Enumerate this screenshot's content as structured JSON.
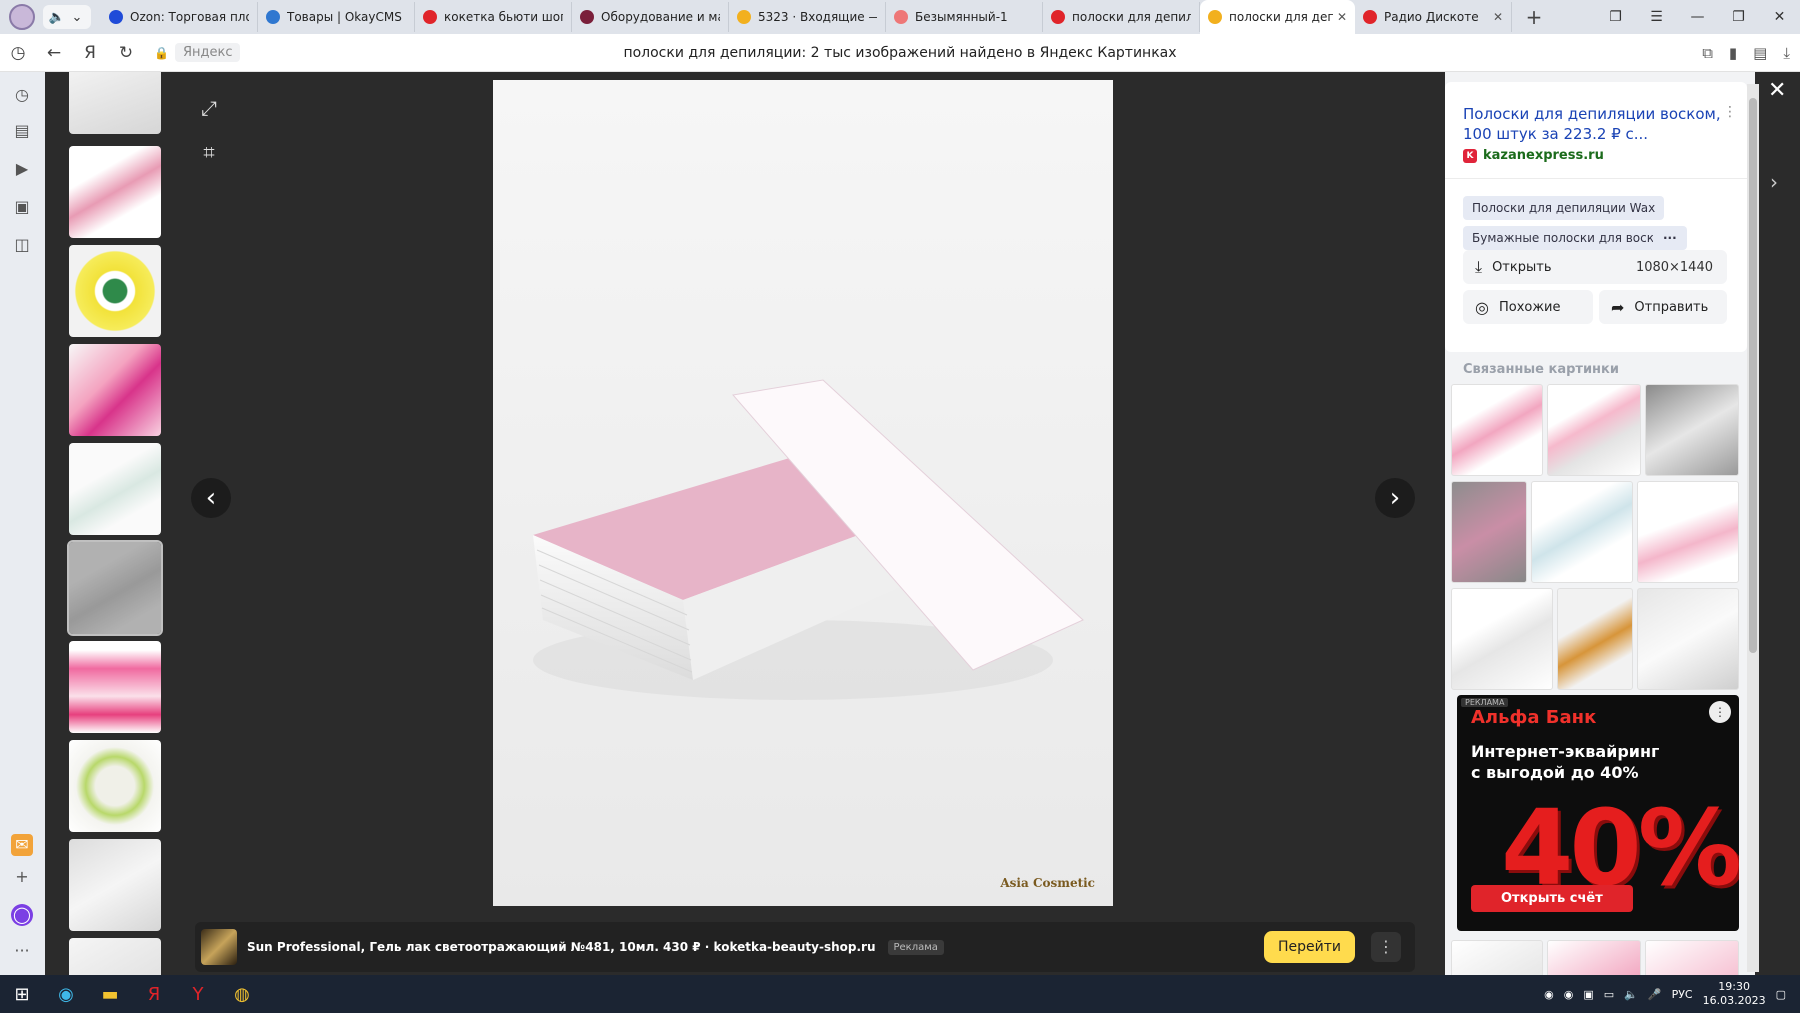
{
  "tabs": [
    {
      "title": "Ozon: Торговая пло",
      "color": "#1f4bd8"
    },
    {
      "title": "Товары | OkayCMS v",
      "color": "#2f77d0"
    },
    {
      "title": "кокетка бьюти шоп",
      "color": "#e0242a"
    },
    {
      "title": "Оборудование и ма",
      "color": "#7a1f3a"
    },
    {
      "title": "5323 · Входящие — ",
      "color": "#f2b01e"
    },
    {
      "title": "Безымянный-1",
      "color": "#e77"
    },
    {
      "title": "полоски для депиля",
      "color": "#e0242a"
    },
    {
      "title": "полоски для депи",
      "color": "#f2b01e",
      "active": true,
      "close": "✕"
    },
    {
      "title": "Радио Дискоте",
      "color": "#e0242a",
      "close": "✕"
    }
  ],
  "address": {
    "host": "Яндекс",
    "title": "полоски для депиляции: 2 тыс изображений найдено в Яндекс Картинках"
  },
  "viewer": {
    "watermark": "Asia Cosmetic"
  },
  "ad_bar": {
    "text": "Sun Professional, Гель лак светоотражающий №481, 10мл. 430 ₽ · koketka-beauty-shop.ru",
    "badge": "Реклама",
    "go_label": "Перейти"
  },
  "panel": {
    "title": "Полоски для депиляции воском, 100 штук за 223.2 ₽ с...",
    "source": "kazanexpress.ru",
    "chips": [
      "Полоски для депиляции Wax",
      "Бумажные полоски для воска",
      "···"
    ],
    "open_label": "Открыть",
    "resolution": "1080×1440",
    "similar_label": "Похожие",
    "share_label": "Отправить",
    "related_title": "Связанные картинки"
  },
  "ad_block": {
    "badge": "РЕКЛАМА",
    "bank": "Альфа Банк",
    "headline": "Интернет-эквайринг с выгодой до 40%",
    "big": "40%",
    "button": "Открыть счёт"
  },
  "taskbar": {
    "lang": "РУС",
    "time": "19:30",
    "date": "16.03.2023"
  }
}
